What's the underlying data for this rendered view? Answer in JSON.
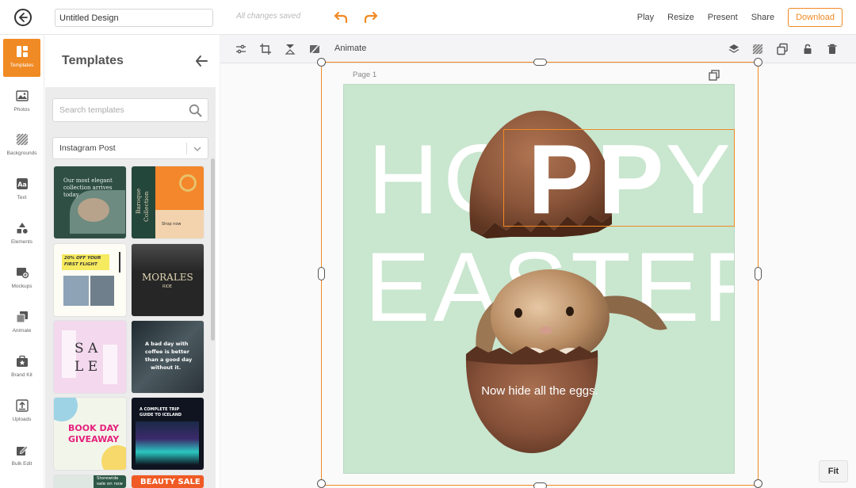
{
  "topbar": {
    "title_value": "Untitled Design",
    "saved_status": "All changes saved",
    "links": [
      "Play",
      "Resize",
      "Present",
      "Share"
    ],
    "download_label": "Download"
  },
  "rail": {
    "items": [
      {
        "label": "Templates",
        "icon": "templates-icon",
        "active": true
      },
      {
        "label": "Photos",
        "icon": "photos-icon"
      },
      {
        "label": "Backgrounds",
        "icon": "backgrounds-icon"
      },
      {
        "label": "Text",
        "icon": "text-icon"
      },
      {
        "label": "Elements",
        "icon": "elements-icon"
      },
      {
        "label": "Mockups",
        "icon": "mockups-icon"
      },
      {
        "label": "Animate",
        "icon": "animate-icon"
      },
      {
        "label": "Brand Kit",
        "icon": "brand-kit-icon"
      },
      {
        "label": "Uploads",
        "icon": "uploads-icon"
      },
      {
        "label": "Bulk Edit",
        "icon": "bulk-edit-icon"
      }
    ]
  },
  "panel": {
    "title": "Templates",
    "search_placeholder": "Search templates",
    "format_selected": "Instagram Post",
    "thumbnails": [
      {
        "lines": [
          "Our most elegant",
          "collection arrives",
          "today"
        ]
      },
      {
        "lines": [
          "Baroque",
          "Collection",
          "Shop now"
        ]
      },
      {
        "lines": [
          "20% OFF YOUR",
          "FIRST FLIGHT"
        ]
      },
      {
        "lines": [
          "MORALES",
          "RIDE"
        ]
      },
      {
        "lines": [
          "S A",
          "L E"
        ]
      },
      {
        "lines": [
          "A bad day with",
          "coffee is better",
          "than a good day",
          "without it."
        ]
      },
      {
        "lines": [
          "BOOK DAY",
          "GIVEAWAY"
        ]
      },
      {
        "lines": [
          "A COMPLETE TRIP",
          "GUIDE TO ICELAND"
        ]
      },
      {
        "lines": [
          "Storewide",
          "sale on now"
        ]
      },
      {
        "lines": [
          "BEAUTY SALE"
        ]
      }
    ]
  },
  "canvas_toolbar": {
    "animate_label": "Animate"
  },
  "canvas": {
    "page_label": "Page 1",
    "headline_top": "HOPPY",
    "headline_bottom": "EASTER",
    "tagline": "Now hide all the eggs.",
    "fit_label": "Fit",
    "background_color": "#c9e6cf",
    "accent_color": "#f08a24"
  }
}
